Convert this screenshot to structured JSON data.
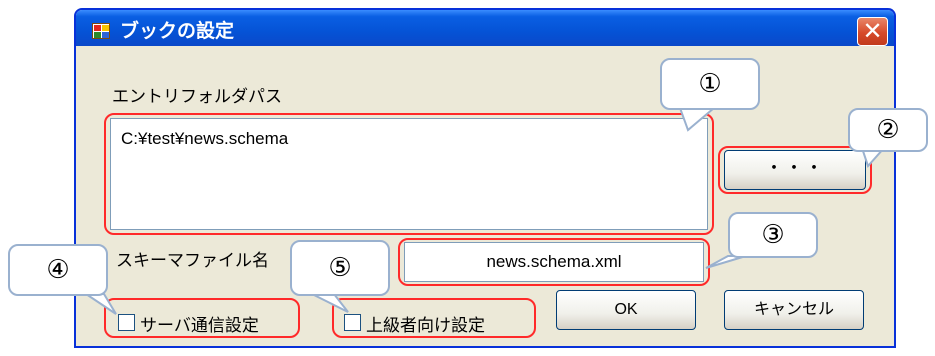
{
  "window": {
    "title": "ブックの設定",
    "close_glyph": "✕"
  },
  "entry_folder": {
    "label": "エントリフォルダパス",
    "value": "C:¥test¥news.schema"
  },
  "browse_button": {
    "label": "・・・"
  },
  "schema_file": {
    "label": "スキーマファイル名",
    "value": "news.schema.xml"
  },
  "options": {
    "server_comm": {
      "label": "サーバ通信設定",
      "checked": false
    },
    "advanced": {
      "label": "上級者向け設定",
      "checked": false
    }
  },
  "buttons": {
    "ok": "OK",
    "cancel": "キャンセル"
  },
  "callouts": [
    "①",
    "②",
    "③",
    "④",
    "⑤"
  ],
  "colors": {
    "highlight": "#ff2a2a",
    "callout_border": "#9ab1cf",
    "titlebar": "#0553d6",
    "dialog": "#ece9d8"
  }
}
